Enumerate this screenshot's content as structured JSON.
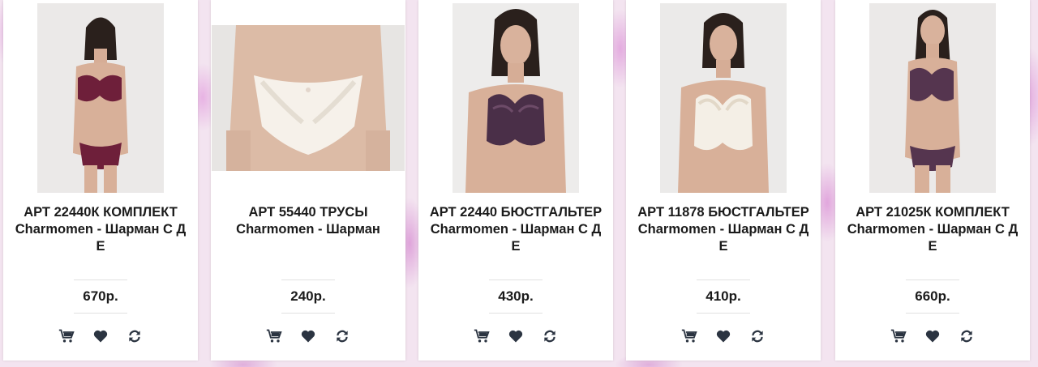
{
  "products": [
    {
      "title": "АРТ 22440К КОМПЛЕКТ Charmomen - Шарман С Д Е",
      "price": "670р.",
      "photo": "model-set-burgundy"
    },
    {
      "title": "АРТ 55440 ТРУСЫ Charmomen - Шарман",
      "price": "240р.",
      "photo": "briefs-white"
    },
    {
      "title": "АРТ 22440 БЮСТГАЛЬТЕР Charmomen - Шарман С Д Е",
      "price": "430р.",
      "photo": "model-bra-purple"
    },
    {
      "title": "АРТ 11878 БЮСТГАЛЬТЕР Charmomen - Шарман С Д Е",
      "price": "410р.",
      "photo": "model-bra-ivory"
    },
    {
      "title": "АРТ 21025К КОМПЛЕКТ Charmomen - Шарман С Д Е",
      "price": "660р.",
      "photo": "model-set-plum"
    }
  ],
  "icons": {
    "cart": "cart-icon",
    "wishlist": "heart-icon",
    "compare": "refresh-icon"
  },
  "colors": {
    "icon": "#2b3441",
    "text": "#1b1b1b",
    "card": "#ffffff"
  }
}
